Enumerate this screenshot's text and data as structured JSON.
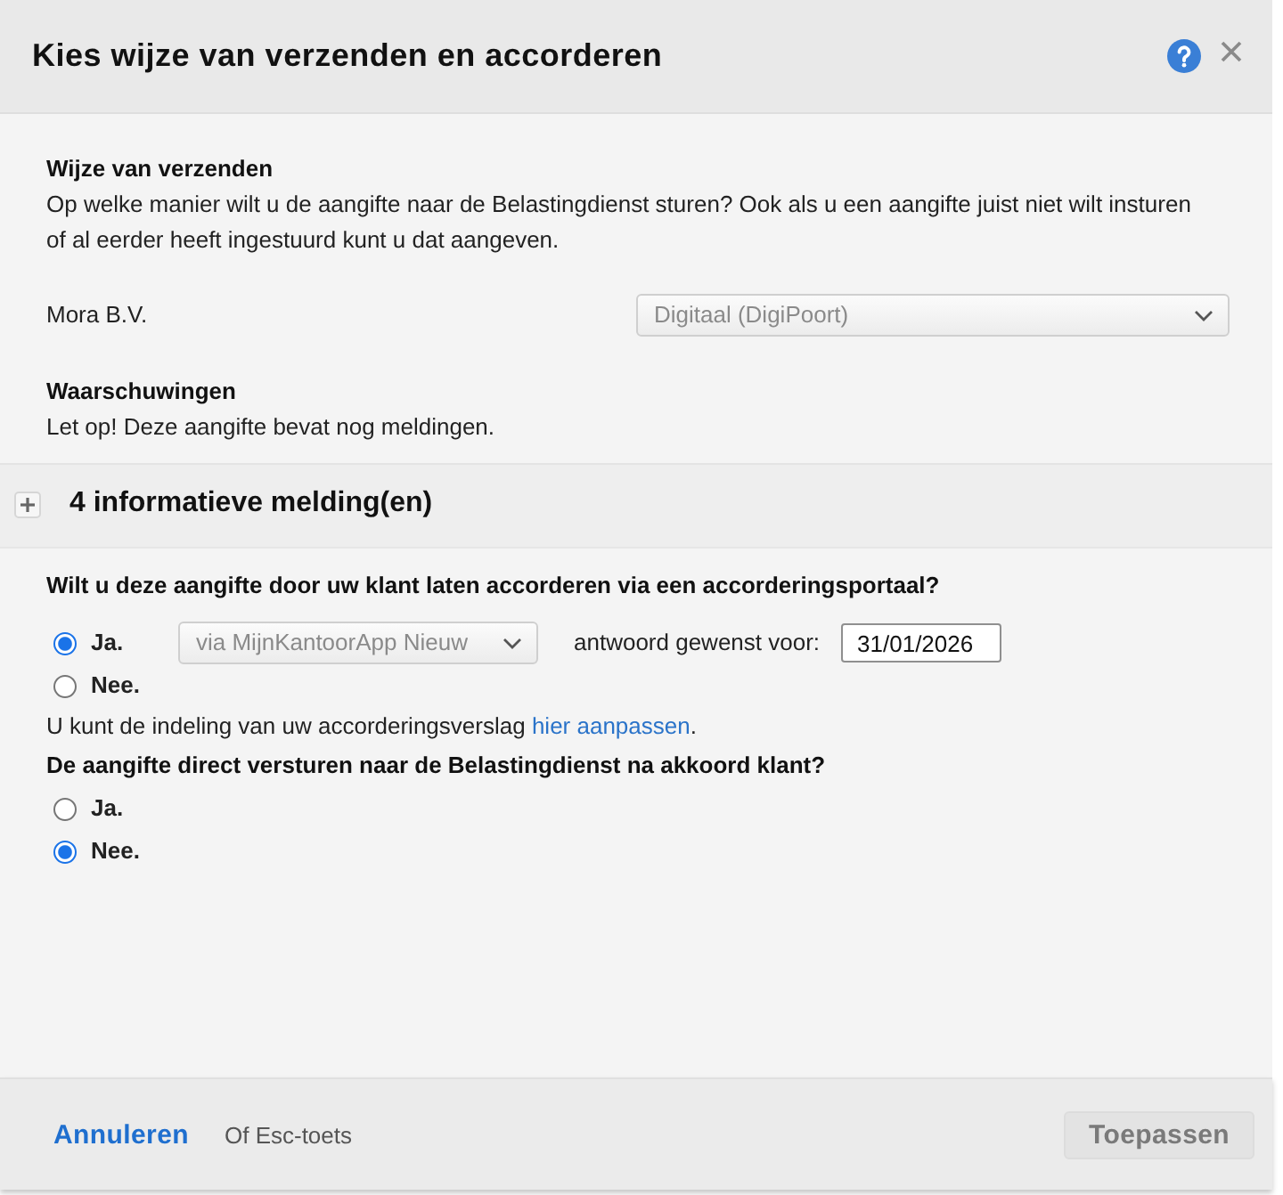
{
  "dialog": {
    "title": "Kies wijze van verzenden en accorderen"
  },
  "sending": {
    "heading": "Wijze van verzenden",
    "description": "Op welke manier wilt u de aangifte naar de Belastingdienst sturen? Ook als u een aangifte juist niet wilt insturen of al eerder heeft ingestuurd kunt u dat aangeven.",
    "client": "Mora B.V.",
    "method": {
      "value": "Digitaal (DigiPoort)",
      "disabled": true
    }
  },
  "warnings": {
    "heading": "Waarschuwingen",
    "text": "Let op! Deze aangifte bevat nog meldingen."
  },
  "notifications": {
    "label": "4 informatieve melding(en)",
    "expanded": false
  },
  "approval": {
    "question": "Wilt u deze aangifte door uw klant laten accorderen via een accorderingsportaal?",
    "options": [
      {
        "label": "Ja.",
        "selected": true
      },
      {
        "label": "Nee.",
        "selected": false
      }
    ],
    "portal": {
      "value": "via MijnKantoorApp Nieuw",
      "disabled": true
    },
    "deadline_label": "antwoord gewenst voor:",
    "deadline": "31/01/2026"
  },
  "layout_note": {
    "text": "U kunt de indeling van uw accorderingsverslag",
    "link": "hier aanpassen",
    "after": "."
  },
  "auto_send": {
    "question": "De aangifte direct versturen naar de Belastingdienst na akkoord klant?",
    "options": [
      {
        "label": "Ja.",
        "selected": false
      },
      {
        "label": "Nee.",
        "selected": true
      }
    ]
  },
  "footer": {
    "cancel": "Annuleren",
    "hint": "Of Esc-toets",
    "apply": {
      "label": "Toepassen",
      "disabled": true
    }
  }
}
